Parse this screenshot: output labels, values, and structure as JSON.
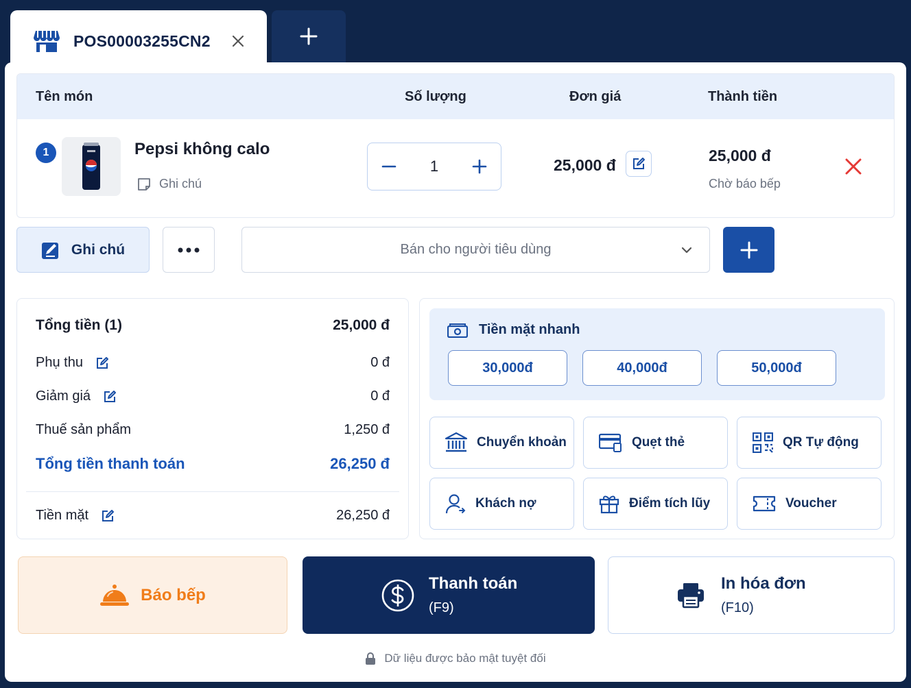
{
  "tab": {
    "title": "POS00003255CN2"
  },
  "table": {
    "headers": {
      "name": "Tên món",
      "qty": "Số lượng",
      "price": "Đơn giá",
      "total": "Thành tiền"
    },
    "items": [
      {
        "index": "1",
        "name": "Pepsi không calo",
        "note_label": "Ghi chú",
        "qty": "1",
        "price": "25,000 đ",
        "total": "25,000 đ",
        "status": "Chờ báo bếp"
      }
    ]
  },
  "actions": {
    "note_label": "Ghi chú",
    "customer_select": "Bán cho người tiêu dùng"
  },
  "summary": {
    "subtotal_label": "Tổng tiền (1)",
    "subtotal_value": "25,000 đ",
    "surcharge_label": "Phụ thu",
    "surcharge_value": "0 đ",
    "discount_label": "Giảm giá",
    "discount_value": "0 đ",
    "tax_label": "Thuế sản phẩm",
    "tax_value": "1,250 đ",
    "grand_label": "Tổng tiền thanh toán",
    "grand_value": "26,250 đ",
    "cash_label": "Tiền mặt",
    "cash_value": "26,250 đ"
  },
  "payment": {
    "quick_title": "Tiền mặt nhanh",
    "quick_amounts": [
      "30,000đ",
      "40,000đ",
      "50,000đ"
    ],
    "methods": [
      "Chuyển khoản",
      "Quẹt thẻ",
      "QR Tự động",
      "Khách nợ",
      "Điểm tích lũy",
      "Voucher"
    ]
  },
  "bottom": {
    "kitchen_label": "Báo bếp",
    "pay_label": "Thanh toán",
    "pay_shortcut": "(F9)",
    "print_label": "In hóa đơn",
    "print_shortcut": "(F10)"
  },
  "footer": {
    "text": "Dữ liệu được bảo mật tuyệt đối"
  },
  "colors": {
    "navy": "#0f2a5c",
    "accent": "#1a56b8",
    "orange": "#f07d1a",
    "danger": "#e53935",
    "light_blue": "#e8f0fc"
  }
}
